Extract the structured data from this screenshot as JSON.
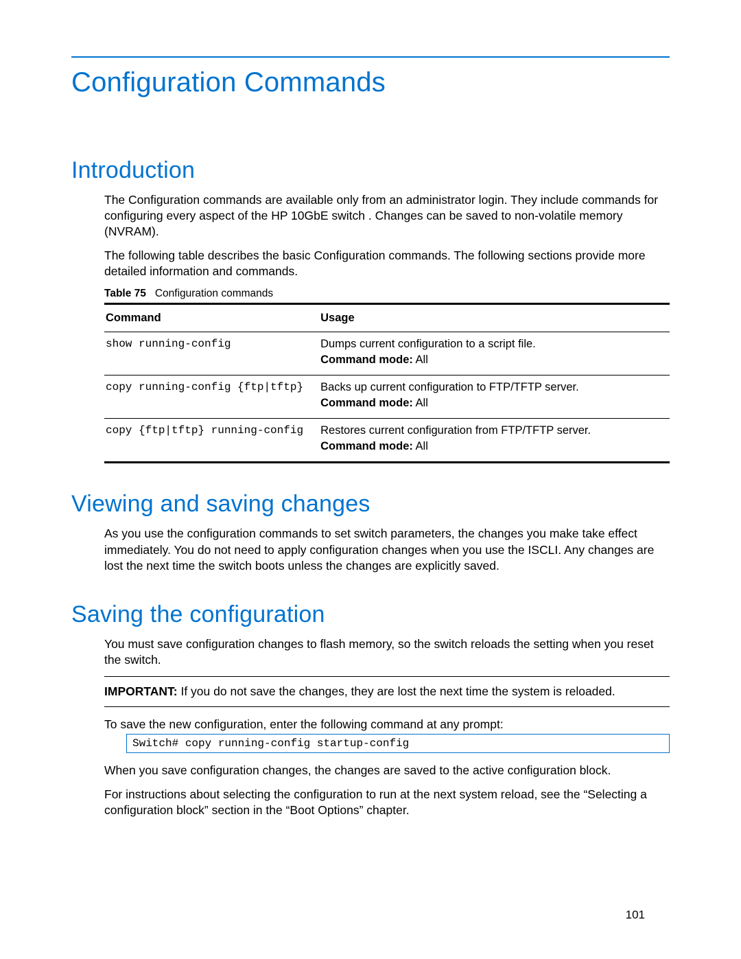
{
  "title": "Configuration Commands",
  "sections": {
    "intro": {
      "heading": "Introduction",
      "p1": "The Configuration commands are available only from an administrator login. They include commands for configuring every aspect of the HP 10GbE switch . Changes can be saved to non-volatile memory (NVRAM).",
      "p2": "The following table describes the basic Configuration commands. The following sections provide more detailed information and commands."
    },
    "table": {
      "caption_label": "Table 75",
      "caption_text": "Configuration commands",
      "header": {
        "col1": "Command",
        "col2": "Usage"
      },
      "mode_label": "Command mode:",
      "mode_value": " All",
      "rows": [
        {
          "cmd": "show running-config",
          "usage": "Dumps current configuration to a script file."
        },
        {
          "cmd": "copy running-config {ftp|tftp}",
          "usage": "Backs up current configuration to FTP/TFTP server."
        },
        {
          "cmd": "copy {ftp|tftp} running-config",
          "usage": "Restores current configuration from FTP/TFTP server."
        }
      ]
    },
    "viewing": {
      "heading": "Viewing and saving changes",
      "p1": "As you use the configuration commands to set switch parameters, the changes you make take effect immediately. You do not need to apply configuration changes when you use the ISCLI. Any changes are lost the next time the switch boots unless the changes are explicitly saved."
    },
    "saving": {
      "heading": "Saving the configuration",
      "p1": "You must save configuration changes to flash memory, so the switch reloads the setting when you reset the switch.",
      "important_label": "IMPORTANT:",
      "important_text": " If you do not save the changes, they are lost the next time the system is reloaded.",
      "p2": "To save the new configuration, enter the following command at any prompt:",
      "code": "Switch# copy running-config startup-config",
      "p3": "When you save configuration changes, the changes are saved to the active configuration block.",
      "p4": "For instructions about selecting the configuration to run at the next system reload, see the “Selecting a configuration block” section in the “Boot Options” chapter."
    }
  },
  "page_number": "101"
}
